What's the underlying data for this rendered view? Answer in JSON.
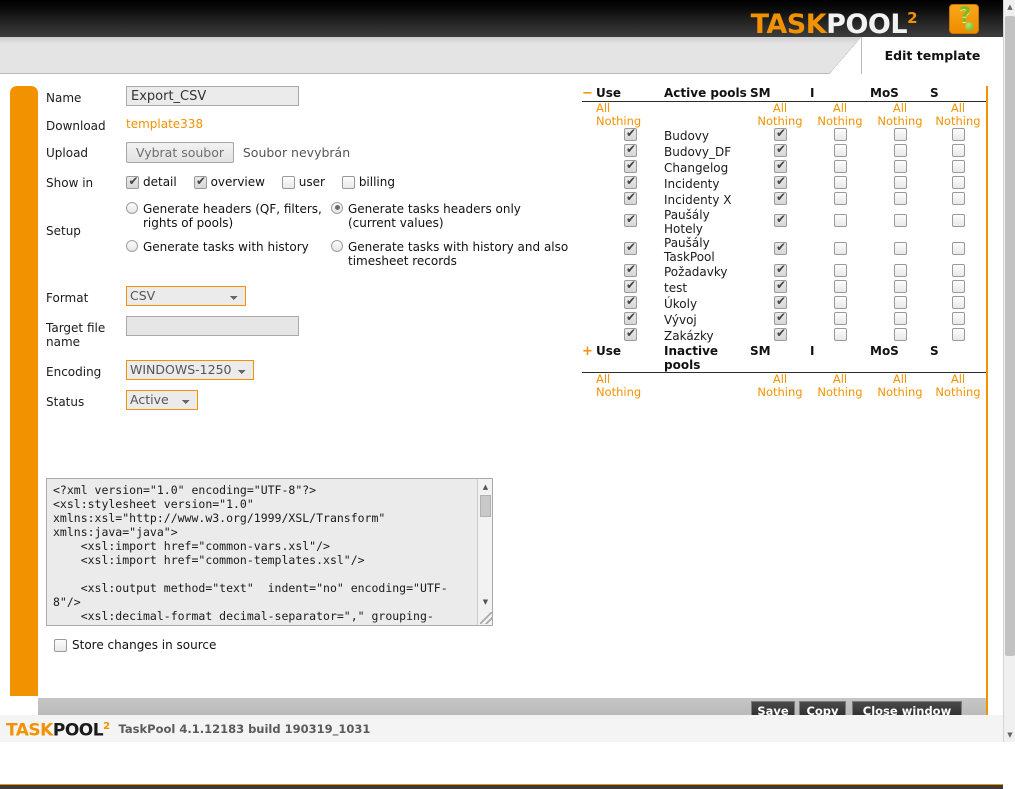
{
  "header": {
    "logo_prefix": "TASK",
    "logo_suffix": "POOL",
    "logo_sup": "2",
    "help_icon_glyph": "?",
    "tab_label": "Edit template"
  },
  "form": {
    "name": {
      "label": "Name",
      "value": "Export_CSV"
    },
    "download": {
      "label": "Download",
      "link_text": "template338"
    },
    "upload": {
      "label": "Upload",
      "button_label": "Vybrat soubor",
      "file_status": "Soubor nevybrán"
    },
    "show_in": {
      "label": "Show in",
      "options": [
        {
          "label": "detail",
          "checked": true
        },
        {
          "label": "overview",
          "checked": true
        },
        {
          "label": "user",
          "checked": false
        },
        {
          "label": "billing",
          "checked": false
        }
      ]
    },
    "setup": {
      "label": "Setup",
      "options": [
        {
          "label": "Generate headers (QF, filters, rights of pools)",
          "checked": false
        },
        {
          "label": "Generate tasks headers only (current values)",
          "checked": true
        },
        {
          "label": "Generate tasks with history",
          "checked": false
        },
        {
          "label": "Generate tasks with history and also timesheet records",
          "checked": false
        }
      ]
    },
    "format": {
      "label": "Format",
      "value": "CSV",
      "options": [
        "CSV"
      ]
    },
    "target_file_name": {
      "label": "Target file name",
      "value": "",
      "placeholder": ""
    },
    "encoding": {
      "label": "Encoding",
      "value": "WINDOWS-1250",
      "options": [
        "WINDOWS-1250"
      ]
    },
    "status": {
      "label": "Status",
      "value": "Active",
      "options": [
        "Active"
      ]
    },
    "xml": {
      "content": "<?xml version=\"1.0\" encoding=\"UTF-8\"?>\n<xsl:stylesheet version=\"1.0\"\nxmlns:xsl=\"http://www.w3.org/1999/XSL/Transform\"\nxmlns:java=\"java\">\n    <xsl:import href=\"common-vars.xsl\"/>\n    <xsl:import href=\"common-templates.xsl\"/>\n\n    <xsl:output method=\"text\"  indent=\"no\" encoding=\"UTF-\n8\"/>\n    <xsl:decimal-format decimal-separator=\",\" grouping-"
    },
    "store_changes": {
      "label": "Store changes in source",
      "checked": false
    }
  },
  "pools": {
    "active_header": {
      "toggle": "−",
      "use": "Use",
      "name": "Active pools",
      "sm": "SM",
      "i": "I",
      "mos": "MoS",
      "s": "S"
    },
    "inactive_header": {
      "toggle": "+",
      "use": "Use",
      "name": "Inactive pools",
      "sm": "SM",
      "i": "I",
      "mos": "MoS",
      "s": "S"
    },
    "all_label": "All",
    "nothing_label": "Nothing",
    "rows": [
      {
        "name": "Budovy",
        "use": true,
        "sm": true,
        "i": false,
        "mos": false,
        "s": false
      },
      {
        "name": "Budovy_DF",
        "use": true,
        "sm": true,
        "i": false,
        "mos": false,
        "s": false
      },
      {
        "name": "Changelog",
        "use": true,
        "sm": true,
        "i": false,
        "mos": false,
        "s": false
      },
      {
        "name": "Incidenty",
        "use": true,
        "sm": true,
        "i": false,
        "mos": false,
        "s": false
      },
      {
        "name": "Incidenty X",
        "use": true,
        "sm": true,
        "i": false,
        "mos": false,
        "s": false
      },
      {
        "name": "Paušály Hotely",
        "use": true,
        "sm": true,
        "i": false,
        "mos": false,
        "s": false
      },
      {
        "name": "Paušály TaskPool",
        "use": true,
        "sm": true,
        "i": false,
        "mos": false,
        "s": false
      },
      {
        "name": "Požadavky",
        "use": true,
        "sm": true,
        "i": false,
        "mos": false,
        "s": false
      },
      {
        "name": "test",
        "use": true,
        "sm": true,
        "i": false,
        "mos": false,
        "s": false
      },
      {
        "name": "Úkoly",
        "use": true,
        "sm": true,
        "i": false,
        "mos": false,
        "s": false
      },
      {
        "name": "Vývoj",
        "use": true,
        "sm": true,
        "i": false,
        "mos": false,
        "s": false
      },
      {
        "name": "Zakázky",
        "use": true,
        "sm": true,
        "i": false,
        "mos": false,
        "s": false
      }
    ]
  },
  "actions": {
    "save": "Save",
    "copy": "Copy",
    "close": "Close window"
  },
  "statusbar": {
    "logo_prefix": "TASK",
    "logo_suffix": "POOL",
    "logo_sup": "2",
    "version": "TaskPool 4.1.12183 build 190319_1031"
  },
  "colors": {
    "accent": "#f39200",
    "header_dark": "#1a1a1a",
    "link": "#f39200"
  }
}
